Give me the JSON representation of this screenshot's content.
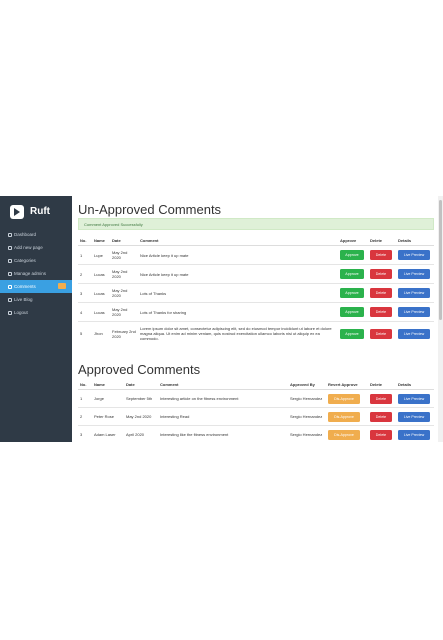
{
  "brand": {
    "name": "Ruft"
  },
  "sidebar": {
    "items": [
      {
        "label": "Dashboard"
      },
      {
        "label": "Add new page"
      },
      {
        "label": "Categories"
      },
      {
        "label": "Manage admins"
      },
      {
        "label": "Comments"
      },
      {
        "label": "Live Blog"
      },
      {
        "label": "Logout"
      }
    ]
  },
  "unapproved": {
    "title": "Un-Approved Comments",
    "alert": "Comment Approved Successfully",
    "headers": [
      "No.",
      "Name",
      "Date",
      "Comment",
      "Approve",
      "Delete",
      "Details"
    ],
    "rows": [
      {
        "no": "1",
        "name": "Lupe",
        "date": "May 2nd 2020",
        "comment": "Nice Article keep it up mate"
      },
      {
        "no": "2",
        "name": "Lucas",
        "date": "May 2nd 2020",
        "comment": "Nice Article keep it up mate"
      },
      {
        "no": "3",
        "name": "Lucas",
        "date": "May 2nd 2020",
        "comment": "Lots of Thanks"
      },
      {
        "no": "4",
        "name": "Lucas",
        "date": "May 2nd 2020",
        "comment": "Lots of Thanks for sharing"
      },
      {
        "no": "5",
        "name": "Jhon",
        "date": "February 2nd 2020",
        "comment": "Lorem ipsum dolor sit amet, consectetur adipiscing elit, sed do eiusmod tempor incididunt ut labore et dolore magna aliqua. Ut enim ad minim veniam, quis nostrud exercitation ullamco laboris nisi ut aliquip ex ea commodo."
      }
    ],
    "approve_label": "Approve",
    "delete_label": "Delete",
    "details_label": "Live Preview"
  },
  "approved": {
    "title": "Approved Comments",
    "headers": [
      "No.",
      "Name",
      "Date",
      "Comment",
      "Approved By",
      "Revert Approve",
      "Delete",
      "Details"
    ],
    "rows": [
      {
        "no": "1",
        "name": "Jorge",
        "date": "September 5th",
        "comment": "Interesting article on the fitness environment",
        "by": "Sergio Hernandez"
      },
      {
        "no": "2",
        "name": "Peter Rose",
        "date": "May 2nd 2020",
        "comment": "Interesting Read",
        "by": "Sergio Hernandez"
      },
      {
        "no": "3",
        "name": "Adam Laser",
        "date": "April 2020",
        "comment": "Interesting like the fitness environment",
        "by": "Sergio Hernandez"
      }
    ],
    "revert_label": "Dis-Approve",
    "delete_label": "Delete",
    "details_label": "Live Preview"
  }
}
